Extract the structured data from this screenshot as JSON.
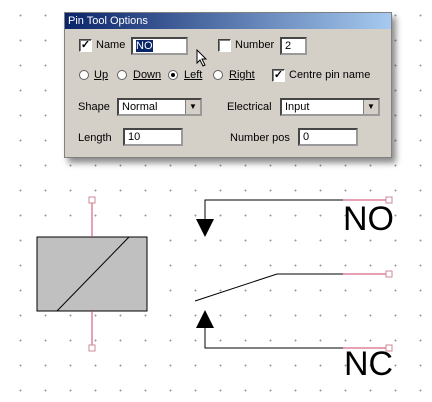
{
  "dialog": {
    "title": "Pin Tool Options",
    "name_label": "Name",
    "name_value": "NO",
    "name_checked": true,
    "number_label": "Number",
    "number_value": "2",
    "number_checked": false,
    "direction": {
      "up": "Up",
      "down": "Down",
      "left": "Left",
      "right": "Right",
      "selected": "Left"
    },
    "centre_pin_name_label": "Centre pin name",
    "centre_pin_name_checked": true,
    "shape_label": "Shape",
    "shape_value": "Normal",
    "electrical_label": "Electrical",
    "electrical_value": "Input",
    "length_label": "Length",
    "length_value": "10",
    "number_pos_label": "Number pos",
    "number_pos_value": "0"
  },
  "schematic": {
    "pin_label_no": "NO",
    "pin_label_nc": "NC"
  },
  "colors": {
    "pin_line": "#cc4466",
    "title_gradient_start": "#0a246a",
    "title_gradient_end": "#a6caf0",
    "coil_fill": "#c0c0c0"
  }
}
